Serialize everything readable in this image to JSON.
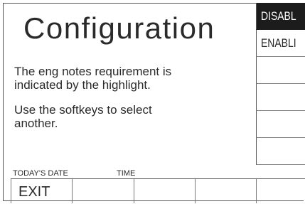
{
  "screen": {
    "title": "Configuration",
    "message_line1a": "The eng notes requirement is",
    "message_line1b": "indicated by the highlight.",
    "message_line2a": "Use the softkeys to select",
    "message_line2b": "another.",
    "todays_date_label": "TODAY'S DATE",
    "time_label": "TIME"
  },
  "softkeys": [
    {
      "label": "DISABL",
      "selected": true
    },
    {
      "label": "ENABLI",
      "selected": false
    },
    {
      "label": "",
      "selected": false
    },
    {
      "label": "",
      "selected": false
    },
    {
      "label": "",
      "selected": false
    },
    {
      "label": "",
      "selected": false
    }
  ],
  "function_keys": [
    {
      "label": "EXIT"
    },
    {
      "label": ""
    },
    {
      "label": ""
    },
    {
      "label": ""
    },
    {
      "label": ""
    }
  ],
  "colors": {
    "selected_background": "#1c1c1c",
    "selected_text": "#ffffff",
    "text": "#2a2a2a"
  }
}
